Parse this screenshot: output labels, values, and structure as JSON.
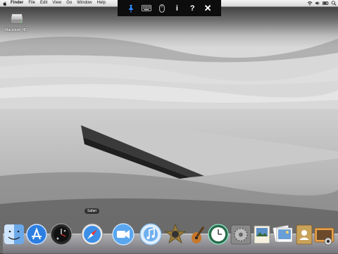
{
  "menubar": {
    "app_name": "Finder",
    "items": [
      "File",
      "Edit",
      "View",
      "Go",
      "Window",
      "Help"
    ]
  },
  "desktop": {
    "hd_label": "Macintosh HD"
  },
  "toolbar": {
    "buttons": [
      {
        "icon": "pin-icon"
      },
      {
        "icon": "keyboard-icon"
      },
      {
        "icon": "mouse-icon"
      },
      {
        "icon": "info-icon",
        "glyph": "i"
      },
      {
        "icon": "help-icon",
        "glyph": "?"
      },
      {
        "icon": "close-icon",
        "glyph": "✕"
      }
    ]
  },
  "dock": {
    "tooltip": "Safari",
    "items": [
      {
        "name": "finder",
        "icon": "finder-icon"
      },
      {
        "name": "app-store",
        "icon": "app-store-icon"
      },
      {
        "name": "dashboard",
        "icon": "dashboard-icon"
      },
      {
        "name": "safari",
        "icon": "safari-icon"
      },
      {
        "name": "facetime",
        "icon": "facetime-icon"
      },
      {
        "name": "itunes",
        "icon": "itunes-icon"
      },
      {
        "name": "imovie",
        "icon": "imovie-icon"
      },
      {
        "name": "garageband",
        "icon": "garageband-icon"
      },
      {
        "name": "time-machine",
        "icon": "time-machine-icon"
      },
      {
        "name": "system-preferences",
        "icon": "system-preferences-icon"
      },
      {
        "name": "preview",
        "icon": "preview-icon"
      },
      {
        "name": "photo-app",
        "icon": "photo-icon"
      },
      {
        "name": "contacts",
        "icon": "contacts-icon"
      },
      {
        "name": "image-capture",
        "icon": "image-capture-icon"
      }
    ]
  },
  "colors": {
    "toolbar_bg": "#0d0d0d",
    "pin_blue": "#2f8cff"
  }
}
